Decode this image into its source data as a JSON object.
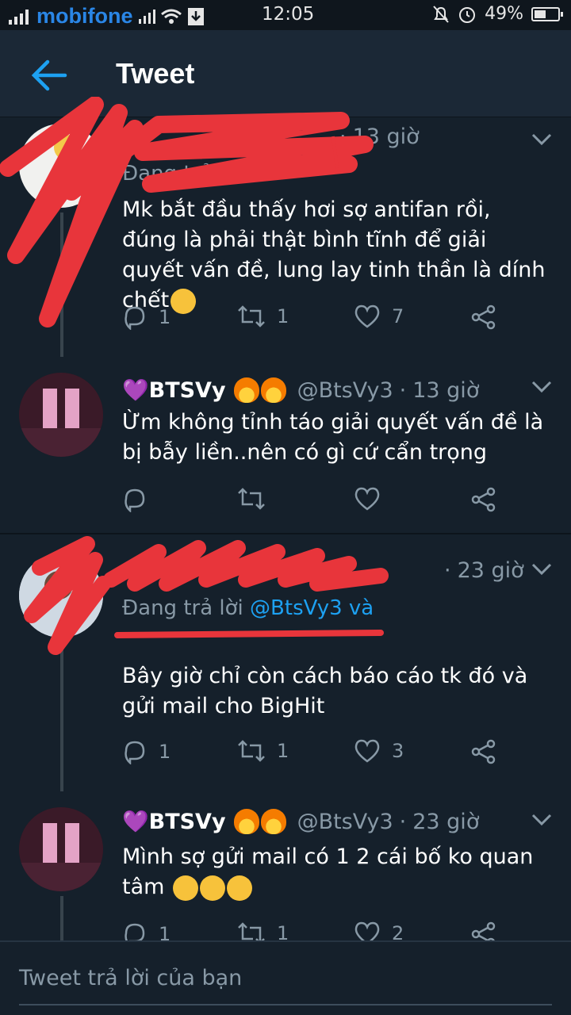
{
  "status_bar": {
    "carrier": "mobifone",
    "time": "12:05",
    "battery": "49%",
    "battery_level": 0.49
  },
  "header": {
    "title": "Tweet",
    "back_icon": "arrow-left-icon"
  },
  "tweets": [
    {
      "time": "13 giờ",
      "reply_label": "Đang trả lời",
      "text": "Mk bắt đầu thấy hơi sợ antifan rồi, đúng là phải thật bình tĩnh để giải quyết vấn đề, lung lay tinh thần là dính chết",
      "replies": "1",
      "retweets": "1",
      "likes": "7"
    },
    {
      "name": "💜BTSVy",
      "handle": "@BtsVy3",
      "separator": "·",
      "time": "13 giờ",
      "text": "Ừm không tỉnh táo giải quyết vấn đề là bị bẫy liền..nên có gì cứ cẩn trọng",
      "replies": "",
      "retweets": "",
      "likes": ""
    },
    {
      "time": "23 giờ",
      "reply_label": "Đang trả lời",
      "reply_mentions": "@BtsVy3 và",
      "text": "Bây giờ chỉ còn cách báo cáo tk đó và gửi mail cho BigHit",
      "replies": "1",
      "retweets": "1",
      "likes": "3"
    },
    {
      "name": "💜BTSVy",
      "handle": "@BtsVy3",
      "separator": "·",
      "time": "23 giờ",
      "text": "Mình sợ gửi mail có 1 2 cái bố ko quan tâm",
      "replies": "1",
      "retweets": "1",
      "likes": "2"
    }
  ],
  "compose": {
    "placeholder": "Tweet trả lời của bạn"
  },
  "colors": {
    "background": "#15202b",
    "header": "#1b2836",
    "accent": "#1da1f2",
    "secondary_text": "#8899a6",
    "scribble": "#e8353b"
  }
}
